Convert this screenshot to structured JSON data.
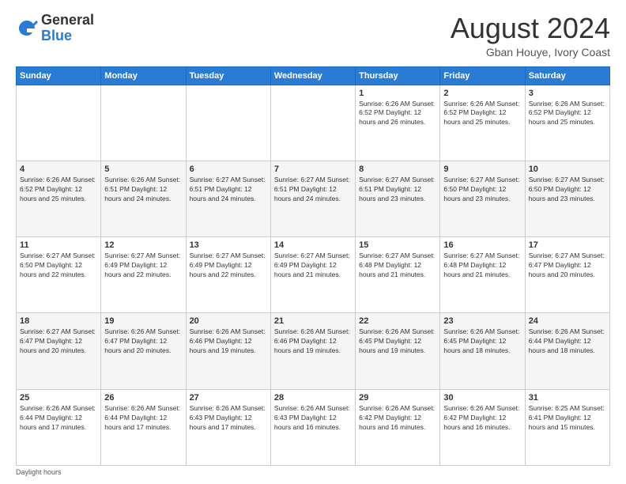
{
  "logo": {
    "general": "General",
    "blue": "Blue"
  },
  "header": {
    "month_year": "August 2024",
    "location": "Gban Houye, Ivory Coast"
  },
  "weekdays": [
    "Sunday",
    "Monday",
    "Tuesday",
    "Wednesday",
    "Thursday",
    "Friday",
    "Saturday"
  ],
  "weeks": [
    [
      {
        "day": "",
        "detail": ""
      },
      {
        "day": "",
        "detail": ""
      },
      {
        "day": "",
        "detail": ""
      },
      {
        "day": "",
        "detail": ""
      },
      {
        "day": "1",
        "detail": "Sunrise: 6:26 AM\nSunset: 6:52 PM\nDaylight: 12 hours\nand 26 minutes."
      },
      {
        "day": "2",
        "detail": "Sunrise: 6:26 AM\nSunset: 6:52 PM\nDaylight: 12 hours\nand 25 minutes."
      },
      {
        "day": "3",
        "detail": "Sunrise: 6:26 AM\nSunset: 6:52 PM\nDaylight: 12 hours\nand 25 minutes."
      }
    ],
    [
      {
        "day": "4",
        "detail": "Sunrise: 6:26 AM\nSunset: 6:52 PM\nDaylight: 12 hours\nand 25 minutes."
      },
      {
        "day": "5",
        "detail": "Sunrise: 6:26 AM\nSunset: 6:51 PM\nDaylight: 12 hours\nand 24 minutes."
      },
      {
        "day": "6",
        "detail": "Sunrise: 6:27 AM\nSunset: 6:51 PM\nDaylight: 12 hours\nand 24 minutes."
      },
      {
        "day": "7",
        "detail": "Sunrise: 6:27 AM\nSunset: 6:51 PM\nDaylight: 12 hours\nand 24 minutes."
      },
      {
        "day": "8",
        "detail": "Sunrise: 6:27 AM\nSunset: 6:51 PM\nDaylight: 12 hours\nand 23 minutes."
      },
      {
        "day": "9",
        "detail": "Sunrise: 6:27 AM\nSunset: 6:50 PM\nDaylight: 12 hours\nand 23 minutes."
      },
      {
        "day": "10",
        "detail": "Sunrise: 6:27 AM\nSunset: 6:50 PM\nDaylight: 12 hours\nand 23 minutes."
      }
    ],
    [
      {
        "day": "11",
        "detail": "Sunrise: 6:27 AM\nSunset: 6:50 PM\nDaylight: 12 hours\nand 22 minutes."
      },
      {
        "day": "12",
        "detail": "Sunrise: 6:27 AM\nSunset: 6:49 PM\nDaylight: 12 hours\nand 22 minutes."
      },
      {
        "day": "13",
        "detail": "Sunrise: 6:27 AM\nSunset: 6:49 PM\nDaylight: 12 hours\nand 22 minutes."
      },
      {
        "day": "14",
        "detail": "Sunrise: 6:27 AM\nSunset: 6:49 PM\nDaylight: 12 hours\nand 21 minutes."
      },
      {
        "day": "15",
        "detail": "Sunrise: 6:27 AM\nSunset: 6:48 PM\nDaylight: 12 hours\nand 21 minutes."
      },
      {
        "day": "16",
        "detail": "Sunrise: 6:27 AM\nSunset: 6:48 PM\nDaylight: 12 hours\nand 21 minutes."
      },
      {
        "day": "17",
        "detail": "Sunrise: 6:27 AM\nSunset: 6:47 PM\nDaylight: 12 hours\nand 20 minutes."
      }
    ],
    [
      {
        "day": "18",
        "detail": "Sunrise: 6:27 AM\nSunset: 6:47 PM\nDaylight: 12 hours\nand 20 minutes."
      },
      {
        "day": "19",
        "detail": "Sunrise: 6:26 AM\nSunset: 6:47 PM\nDaylight: 12 hours\nand 20 minutes."
      },
      {
        "day": "20",
        "detail": "Sunrise: 6:26 AM\nSunset: 6:46 PM\nDaylight: 12 hours\nand 19 minutes."
      },
      {
        "day": "21",
        "detail": "Sunrise: 6:26 AM\nSunset: 6:46 PM\nDaylight: 12 hours\nand 19 minutes."
      },
      {
        "day": "22",
        "detail": "Sunrise: 6:26 AM\nSunset: 6:45 PM\nDaylight: 12 hours\nand 19 minutes."
      },
      {
        "day": "23",
        "detail": "Sunrise: 6:26 AM\nSunset: 6:45 PM\nDaylight: 12 hours\nand 18 minutes."
      },
      {
        "day": "24",
        "detail": "Sunrise: 6:26 AM\nSunset: 6:44 PM\nDaylight: 12 hours\nand 18 minutes."
      }
    ],
    [
      {
        "day": "25",
        "detail": "Sunrise: 6:26 AM\nSunset: 6:44 PM\nDaylight: 12 hours\nand 17 minutes."
      },
      {
        "day": "26",
        "detail": "Sunrise: 6:26 AM\nSunset: 6:44 PM\nDaylight: 12 hours\nand 17 minutes."
      },
      {
        "day": "27",
        "detail": "Sunrise: 6:26 AM\nSunset: 6:43 PM\nDaylight: 12 hours\nand 17 minutes."
      },
      {
        "day": "28",
        "detail": "Sunrise: 6:26 AM\nSunset: 6:43 PM\nDaylight: 12 hours\nand 16 minutes."
      },
      {
        "day": "29",
        "detail": "Sunrise: 6:26 AM\nSunset: 6:42 PM\nDaylight: 12 hours\nand 16 minutes."
      },
      {
        "day": "30",
        "detail": "Sunrise: 6:26 AM\nSunset: 6:42 PM\nDaylight: 12 hours\nand 16 minutes."
      },
      {
        "day": "31",
        "detail": "Sunrise: 6:25 AM\nSunset: 6:41 PM\nDaylight: 12 hours\nand 15 minutes."
      }
    ]
  ],
  "footer": {
    "note": "Daylight hours"
  }
}
